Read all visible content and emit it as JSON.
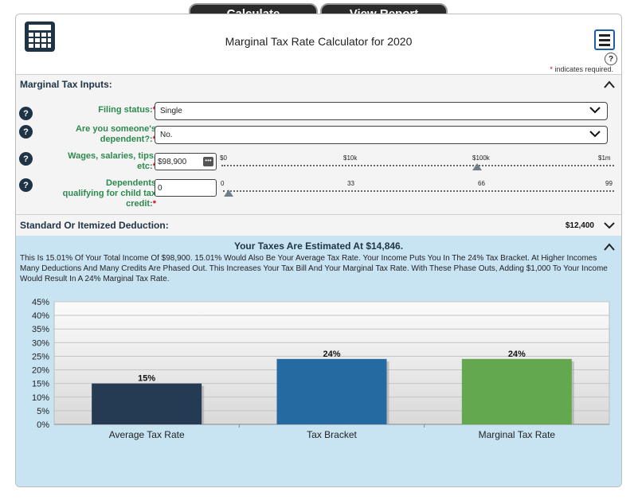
{
  "toolbar": {
    "calculate_label": "Calculate",
    "view_report_label": "View Report"
  },
  "header": {
    "title": "Marginal Tax Rate Calculator for 2020",
    "help_label": "?",
    "required_star": "*",
    "required_note": "indicates required."
  },
  "inputs_section": {
    "title": "Marginal Tax Inputs:",
    "fields": {
      "filing_status": {
        "label": "Filing status:",
        "value": "Single"
      },
      "dependent": {
        "label_line1": "Are you someone's",
        "label_line2": "dependent?:",
        "value": "No."
      },
      "wages": {
        "label_line1": "Wages, salaries, tips,",
        "label_line2": "etc:",
        "value": "$98,900",
        "ticks": [
          "$0",
          "$10k",
          "$100k",
          "$1m"
        ]
      },
      "dependents_child": {
        "label_line1": "Dependents",
        "label_line2": "qualifying for child tax",
        "label_line3": "credit:",
        "value": "0",
        "ticks": [
          "0",
          "33",
          "66",
          "99"
        ]
      }
    },
    "help_label": "?"
  },
  "deduction_section": {
    "title": "Standard Or Itemized Deduction:",
    "value": "$12,400"
  },
  "results_section": {
    "title": "Your Taxes Are Estimated At $14,846.",
    "summary": "This Is 15.01% Of Your Total Income Of $98,900. 15.01% Would Also Be Your Average Tax Rate. Your Income Puts You In The 24% Tax Bracket. At Higher Incomes Many Deductions And Many Credits Are Phased Out. This Increases Your Tax Bill And Your Marginal Tax Rate. With These Phase Outs, Adding $1,000 To Your Income Would Result In A 24% Marginal Tax Rate."
  },
  "colors": {
    "avg": "#243b53",
    "bracket": "#256aa0",
    "marginal": "#63a84f",
    "panel_bg": "#c8e4f3",
    "label_green": "#2d8a4e"
  },
  "chart_data": {
    "type": "bar",
    "categories": [
      "Average Tax Rate",
      "Tax Bracket",
      "Marginal Tax Rate"
    ],
    "values": [
      15,
      24,
      24
    ],
    "data_labels": [
      "15%",
      "24%",
      "24%"
    ],
    "ylim": [
      0,
      45
    ],
    "yticks": [
      "0%",
      "5%",
      "10%",
      "15%",
      "20%",
      "25%",
      "30%",
      "35%",
      "40%",
      "45%"
    ],
    "grid": true
  }
}
